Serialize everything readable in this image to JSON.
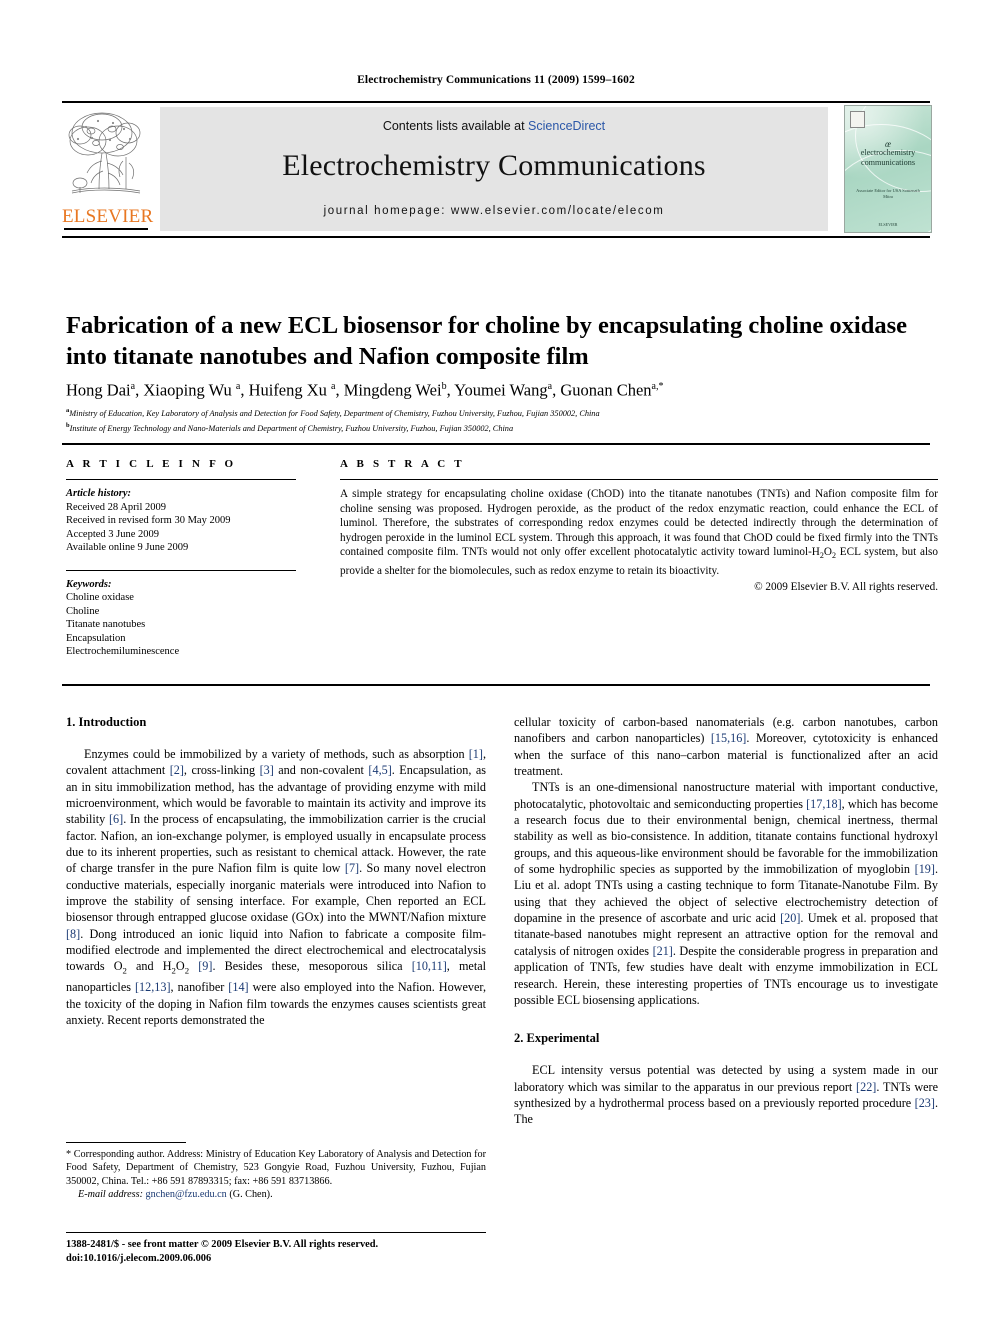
{
  "running_head": "Electrochemistry Communications 11 (2009) 1599–1602",
  "masthead": {
    "contents_prefix": "Contents lists available at ",
    "sciencedirect": "ScienceDirect",
    "journal_title": "Electrochemistry Communications",
    "homepage": "journal homepage: www.elsevier.com/locate/elecom",
    "publisher_logo_text": "ELSEVIER",
    "publisher_logo_color": "#E87722",
    "cover": {
      "at_glyph": "œ",
      "title_line1": "electrochemistry",
      "title_line2": "communications",
      "sub_text": "Associate Editor for USA\nSomenath Mitra",
      "foot_text": "ELSEVIER"
    }
  },
  "article": {
    "title": "Fabrication of a new ECL biosensor for choline by encapsulating choline oxidase into titanate nanotubes and Nafion composite film",
    "authors_html": "Hong Dai<sup>a</sup>, Xiaoping Wu <sup>a</sup>, Huifeng Xu <sup>a</sup>, Mingdeng Wei<sup>b</sup>, Youmei Wang<sup>a</sup>, Guonan Chen<sup>a,*</sup>",
    "affiliations": [
      "Ministry of Education, Key Laboratory of Analysis and Detection for Food Safety, Department of Chemistry, Fuzhou University, Fuzhou, Fujian 350002, China",
      "Institute of Energy Technology and Nano-Materials and Department of Chemistry, Fuzhou University, Fuzhou, Fujian 350002, China"
    ],
    "affiliation_marks": [
      "a",
      "b"
    ]
  },
  "info": {
    "heading": "A R T I C L E  I N F O",
    "history_label": "Article history:",
    "history": [
      "Received 28 April 2009",
      "Received in revised form 30 May 2009",
      "Accepted 3 June 2009",
      "Available online 9 June 2009"
    ],
    "keywords_label": "Keywords:",
    "keywords": [
      "Choline oxidase",
      "Choline",
      "Titanate nanotubes",
      "Encapsulation",
      "Electrochemiluminescence"
    ]
  },
  "abstract": {
    "heading": "A B S T R A C T",
    "body_html": "A simple strategy for encapsulating choline oxidase (ChOD) into the titanate nanotubes (TNTs) and Nafion composite film for choline sensing was proposed. Hydrogen peroxide, as the product of the redox enzymatic reaction, could enhance the ECL of luminol. Therefore, the substrates of corresponding redox enzymes could be detected indirectly through the determination of hydrogen peroxide in the luminol ECL system. Through this approach, it was found that ChOD could be fixed firmly into the TNTs contained composite film. TNTs would not only offer excellent photocatalytic activity toward luminol-H<sub>2</sub>O<sub>2</sub> ECL system, but also provide a shelter for the biomolecules, such as redox enzyme to retain its bioactivity.",
    "copyright": "© 2009 Elsevier B.V. All rights reserved."
  },
  "sections": {
    "introduction_heading": "1. Introduction",
    "experimental_heading": "2. Experimental"
  },
  "body": {
    "left": [
      "Enzymes could be immobilized by a variety of methods, such as absorption <span class=\"ref\">[1]</span>, covalent attachment <span class=\"ref\">[2]</span>, cross-linking <span class=\"ref\">[3]</span> and non-covalent <span class=\"ref\">[4,5]</span>. Encapsulation, as an in situ immobilization method, has the advantage of providing enzyme with mild microenvironment, which would be favorable to maintain its activity and improve its stability <span class=\"ref\">[6]</span>. In the process of encapsulating, the immobilization carrier is the crucial factor. Nafion, an ion-exchange polymer, is employed usually in encapsulate process due to its inherent properties, such as resistant to chemical attack. However, the rate of charge transfer in the pure Nafion film is quite low <span class=\"ref\">[7]</span>. So many novel electron conductive materials, especially inorganic materials were introduced into Nafion to improve the stability of sensing interface. For example, Chen reported an ECL biosensor through entrapped glucose oxidase (GOx) into the MWNT/Nafion mixture <span class=\"ref\">[8]</span>. Dong introduced an ionic liquid into Nafion to fabricate a composite film-modified electrode and implemented the direct electrochemical and electrocatalysis towards O<sub>2</sub> and H<sub>2</sub>O<sub>2</sub> <span class=\"ref\">[9]</span>. Besides these, mesoporous silica <span class=\"ref\">[10,11]</span>, metal nanoparticles <span class=\"ref\">[12,13]</span>, nanofiber <span class=\"ref\">[14]</span> were also employed into the Nafion. However, the toxicity of the doping in Nafion film towards the enzymes causes scientists great anxiety. Recent reports demonstrated the"
    ],
    "right": [
      "cellular toxicity of carbon-based nanomaterials (e.g. carbon nanotubes, carbon nanofibers and carbon nanoparticles) <span class=\"ref\">[15,16]</span>. Moreover, cytotoxicity is enhanced when the surface of this nano–carbon material is functionalized after an acid treatment.",
      "TNTs is an one-dimensional nanostructure material with important conductive, photocatalytic, photovoltaic and semiconducting properties <span class=\"ref\">[17,18]</span>, which has become a research focus due to their environmental benign, chemical inertness, thermal stability as well as bio-consistence. In addition, titanate contains functional hydroxyl groups, and this aqueous-like environment should be favorable for the immobilization of some hydrophilic species as supported by the immobilization of myoglobin <span class=\"ref\">[19]</span>. Liu et al. adopt TNTs using a casting technique to form Titanate-Nanotube Film. By using that they achieved the object of selective electrochemistry detection of dopamine in the presence of ascorbate and uric acid <span class=\"ref\">[20]</span>. Umek et al. proposed that titanate-based nanotubes might represent an attractive option for the removal and catalysis of nitrogen oxides <span class=\"ref\">[21]</span>. Despite the considerable progress in preparation and application of TNTs, few studies have dealt with enzyme immobilization in ECL research. Herein, these interesting properties of TNTs encourage us to investigate possible ECL biosensing applications.",
      "ECL intensity versus potential was detected by using a system made in our laboratory which was similar to the apparatus in our previous report <span class=\"ref\">[22]</span>. TNTs were synthesized by a hydrothermal process based on a previously reported procedure <span class=\"ref\">[23]</span>. The"
    ]
  },
  "footnote": {
    "corresponding": "* Corresponding author. Address: Ministry of Education Key Laboratory of Analysis and Detection for Food Safety, Department of Chemistry, 523 Gongyie Road, Fuzhou University, Fuzhou, Fujian 350002, China. Tel.: +86 591 87893315; fax: +86 591 83713866.",
    "email_label": "E-mail address:",
    "email": "gnchen@fzu.edu.cn",
    "email_owner": "(G. Chen)."
  },
  "imprint": {
    "line1": "1388-2481/$ - see front matter © 2009 Elsevier B.V. All rights reserved.",
    "line2": "doi:10.1016/j.elecom.2009.06.006"
  },
  "colors": {
    "reference_link": "#1b3a73",
    "sciencedirect": "#2b57a8",
    "elsevier_orange": "#E87722",
    "band_grey": "#e4e4e4",
    "cover_green": "#a9d6c2"
  }
}
